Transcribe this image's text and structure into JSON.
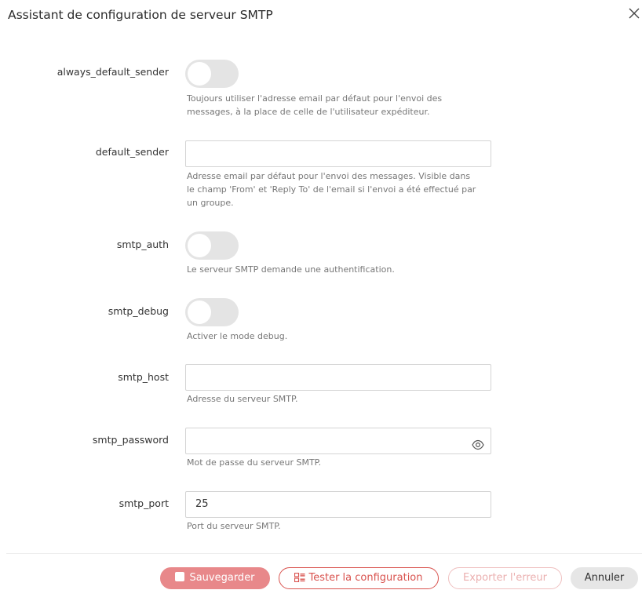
{
  "dialog": {
    "title": "Assistant de configuration de serveur SMTP",
    "close_icon": "close-icon"
  },
  "fields": {
    "always_default_sender": {
      "label": "always_default_sender",
      "type": "toggle",
      "checked": false,
      "help": "Toujours utiliser l'adresse email par défaut pour l'envoi des messages, à la place de celle de l'utilisateur expéditeur."
    },
    "default_sender": {
      "label": "default_sender",
      "type": "text",
      "value": "",
      "help": "Adresse email par défaut pour l'envoi des messages. Visible dans le champ 'From' et 'Reply To' de l'email si l'envoi a été effectué par un groupe."
    },
    "smtp_auth": {
      "label": "smtp_auth",
      "type": "toggle",
      "checked": false,
      "help": "Le serveur SMTP demande une authentification."
    },
    "smtp_debug": {
      "label": "smtp_debug",
      "type": "toggle",
      "checked": false,
      "help": "Activer le mode debug."
    },
    "smtp_host": {
      "label": "smtp_host",
      "type": "text",
      "value": "",
      "help": "Adresse du serveur SMTP."
    },
    "smtp_password": {
      "label": "smtp_password",
      "type": "password",
      "value": "",
      "icon": "eye-icon",
      "help": "Mot de passe du serveur SMTP."
    },
    "smtp_port": {
      "label": "smtp_port",
      "type": "text",
      "value": "25",
      "help": "Port du serveur SMTP."
    }
  },
  "footer": {
    "save_label": "Sauvegarder",
    "save_icon": "save-icon",
    "test_label": "Tester la configuration",
    "test_icon": "list-icon",
    "export_label": "Exporter l'erreur",
    "cancel_label": "Annuler"
  },
  "colors": {
    "primary": "#d9534f",
    "primary_disabled": "#e8888a",
    "toggle_off": "#e4e4e4",
    "help_text": "#777777"
  }
}
